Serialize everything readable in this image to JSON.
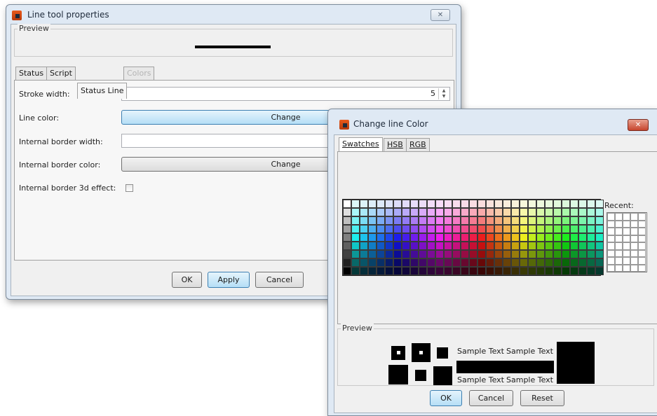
{
  "line_dialog": {
    "title": "Line tool properties",
    "close_glyph": "✕",
    "preview_label": "Preview",
    "tabs": [
      {
        "label": "Status",
        "state": "normal"
      },
      {
        "label": "Script",
        "state": "normal"
      },
      {
        "label": "Status Line",
        "state": "active"
      },
      {
        "label": "Colors",
        "state": "disabled"
      }
    ],
    "fields": {
      "stroke_width_label": "Stroke width:",
      "stroke_width_value": "5",
      "line_color_label": "Line color:",
      "line_color_button": "Change",
      "internal_border_width_label": "Internal border width:",
      "internal_border_color_label": "Internal border color:",
      "internal_border_color_button": "Change",
      "internal_border_3d_label": "Internal border 3d effect:",
      "internal_border_3d_checked": false
    },
    "buttons": {
      "ok": "OK",
      "apply": "Apply",
      "cancel": "Cancel"
    }
  },
  "color_dialog": {
    "title": "Change line Color",
    "close_glyph": "✕",
    "tabs": [
      {
        "label": "Swatches",
        "state": "active"
      },
      {
        "label": "HSB",
        "state": "normal"
      },
      {
        "label": "RGB",
        "state": "normal"
      }
    ],
    "recent_label": "Recent:",
    "preview_label": "Preview",
    "sample_text": "Sample Text",
    "buttons": {
      "ok": "OK",
      "cancel": "Cancel",
      "reset": "Reset"
    }
  },
  "colors": {
    "preview_line": "#000000",
    "selected_color": "#000000"
  }
}
